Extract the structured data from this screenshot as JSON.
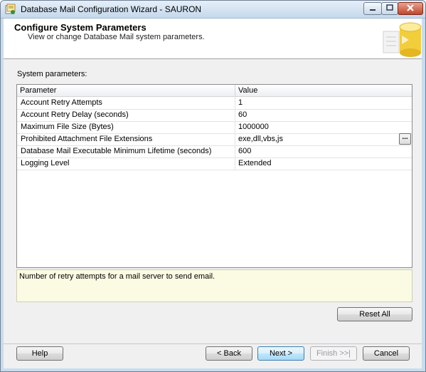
{
  "window": {
    "title": "Database Mail Configuration Wizard - SAURON"
  },
  "header": {
    "title": "Configure System Parameters",
    "subtitle": "View or change Database Mail system parameters."
  },
  "section_label": "System parameters:",
  "grid": {
    "columns": [
      "Parameter",
      "Value"
    ],
    "rows": [
      {
        "param": "Account Retry Attempts",
        "value": "1"
      },
      {
        "param": "Account Retry Delay (seconds)",
        "value": "60"
      },
      {
        "param": "Maximum File Size (Bytes)",
        "value": "1000000"
      },
      {
        "param": "Prohibited Attachment File Extensions",
        "value": "exe,dll,vbs,js"
      },
      {
        "param": "Database Mail Executable Minimum Lifetime (seconds)",
        "value": "600"
      },
      {
        "param": "Logging Level",
        "value": "Extended"
      }
    ],
    "ellipsis_label": "..."
  },
  "description": "Number of retry attempts for a mail server to send email.",
  "buttons": {
    "reset_all": "Reset All",
    "help": "Help",
    "back": "< Back",
    "next": "Next >",
    "finish": "Finish >>|",
    "cancel": "Cancel"
  },
  "colors": {
    "description_background": "#fbfbe3",
    "primary_button_border": "#3c7fb1"
  }
}
